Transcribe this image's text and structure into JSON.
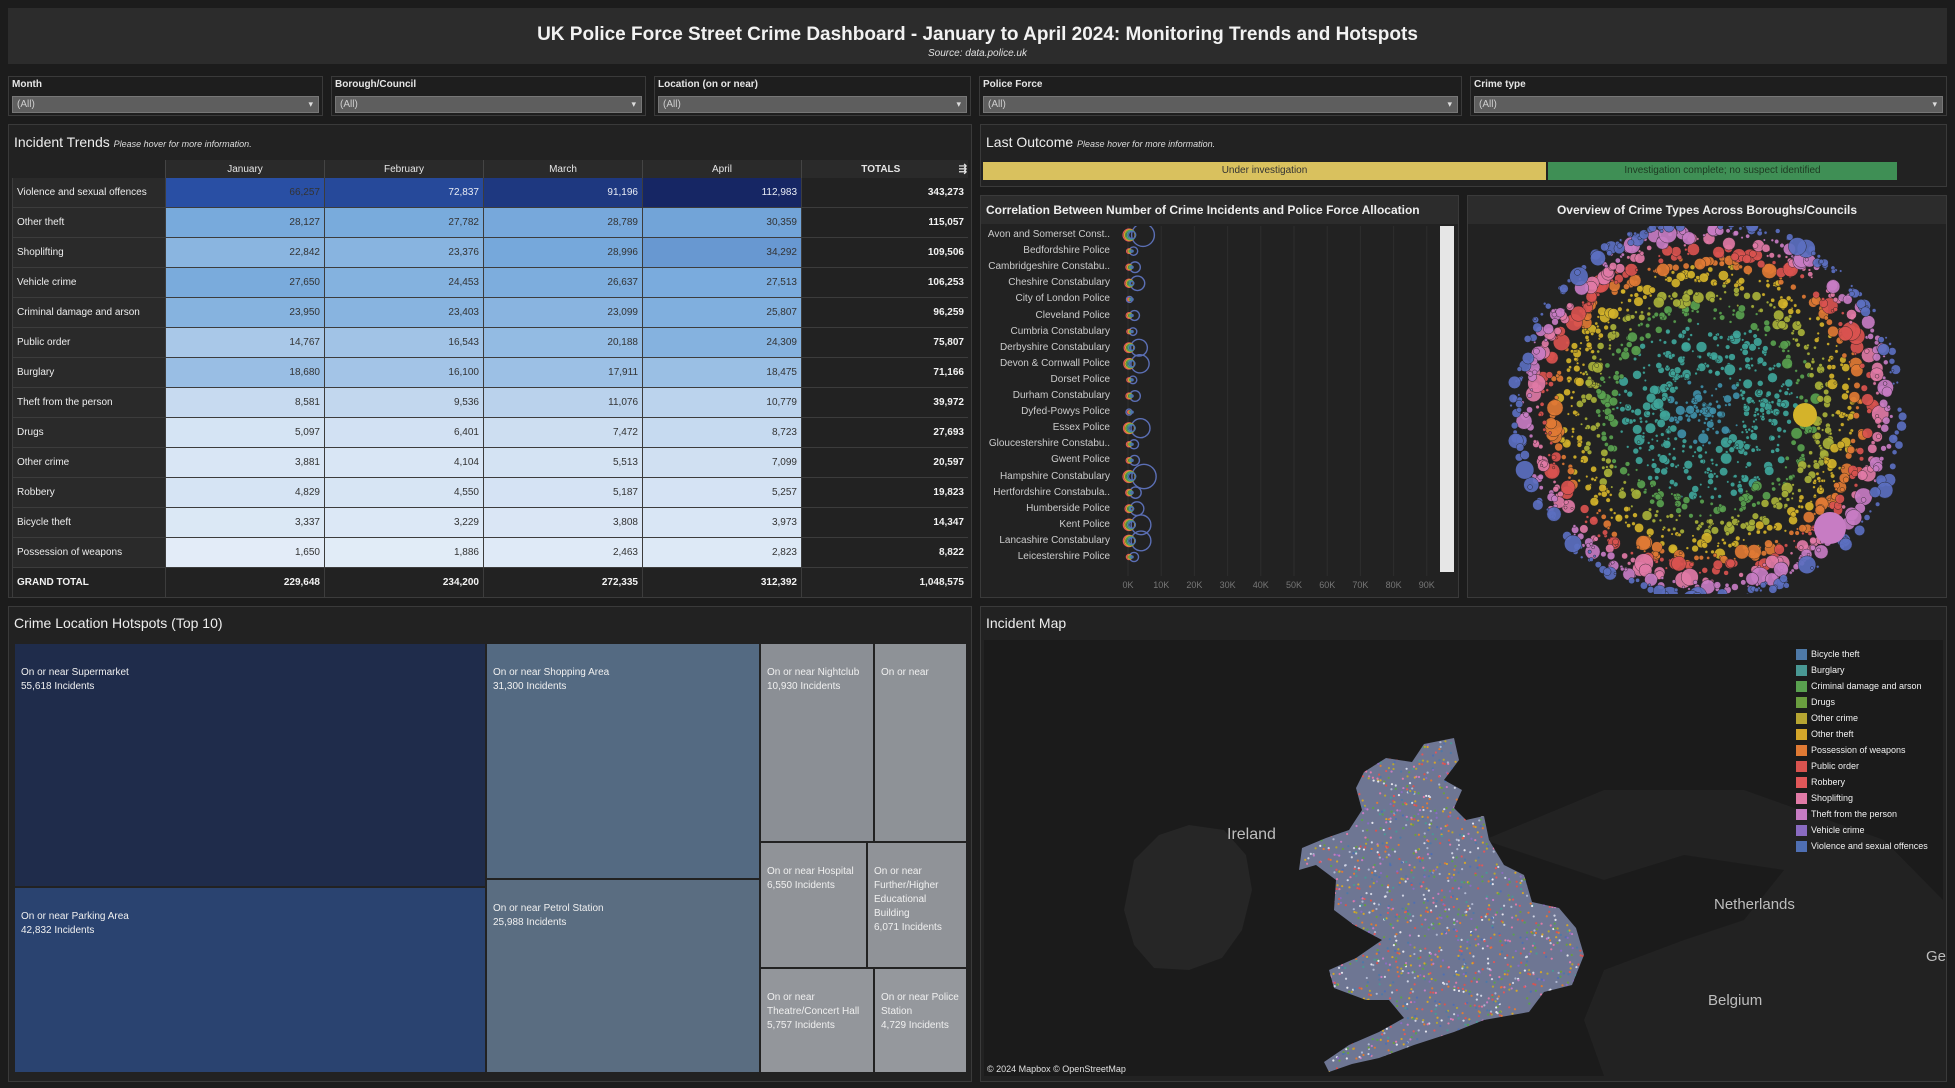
{
  "header": {
    "title": "UK Police Force Street Crime Dashboard - January to April 2024: Monitoring Trends and Hotspots",
    "source": "Source: data.police.uk"
  },
  "filters": [
    {
      "label": "Month",
      "value": "(All)"
    },
    {
      "label": "Borough/Council",
      "value": "(All)"
    },
    {
      "label": "Location (on or near)",
      "value": "(All)"
    },
    {
      "label": "Police Force",
      "value": "(All)"
    },
    {
      "label": "Crime type",
      "value": "(All)"
    }
  ],
  "incident_trends": {
    "title": "Incident Trends",
    "hint": "Please hover for more information.",
    "columns": [
      "January",
      "February",
      "March",
      "April",
      "TOTALS"
    ],
    "rows": [
      {
        "category": "Violence and sexual offences",
        "values": [
          "66,257",
          "72,837",
          "91,196",
          "112,983"
        ],
        "total": "343,273"
      },
      {
        "category": "Other theft",
        "values": [
          "28,127",
          "27,782",
          "28,789",
          "30,359"
        ],
        "total": "115,057"
      },
      {
        "category": "Shoplifting",
        "values": [
          "22,842",
          "23,376",
          "28,996",
          "34,292"
        ],
        "total": "109,506"
      },
      {
        "category": "Vehicle crime",
        "values": [
          "27,650",
          "24,453",
          "26,637",
          "27,513"
        ],
        "total": "106,253"
      },
      {
        "category": "Criminal damage and arson",
        "values": [
          "23,950",
          "23,403",
          "23,099",
          "25,807"
        ],
        "total": "96,259"
      },
      {
        "category": "Public order",
        "values": [
          "14,767",
          "16,543",
          "20,188",
          "24,309"
        ],
        "total": "75,807"
      },
      {
        "category": "Burglary",
        "values": [
          "18,680",
          "16,100",
          "17,911",
          "18,475"
        ],
        "total": "71,166"
      },
      {
        "category": "Theft from the person",
        "values": [
          "8,581",
          "9,536",
          "11,076",
          "10,779"
        ],
        "total": "39,972"
      },
      {
        "category": "Drugs",
        "values": [
          "5,097",
          "6,401",
          "7,472",
          "8,723"
        ],
        "total": "27,693"
      },
      {
        "category": "Other crime",
        "values": [
          "3,881",
          "4,104",
          "5,513",
          "7,099"
        ],
        "total": "20,597"
      },
      {
        "category": "Robbery",
        "values": [
          "4,829",
          "4,550",
          "5,187",
          "5,257"
        ],
        "total": "19,823"
      },
      {
        "category": "Bicycle theft",
        "values": [
          "3,337",
          "3,229",
          "3,808",
          "3,973"
        ],
        "total": "14,347"
      },
      {
        "category": "Possession of weapons",
        "values": [
          "1,650",
          "1,886",
          "2,463",
          "2,823"
        ],
        "total": "8,822"
      }
    ],
    "grand_total": {
      "label": "GRAND TOTAL",
      "values": [
        "229,648",
        "234,200",
        "272,335",
        "312,392"
      ],
      "total": "1,048,575"
    }
  },
  "last_outcome": {
    "title": "Last Outcome",
    "hint": "Please hover for more information.",
    "segments": [
      {
        "label": "Under investigation",
        "color": "#d9c15e"
      },
      {
        "label": "Investigation complete; no suspect identified",
        "color": "#3f8f55"
      }
    ]
  },
  "correlation": {
    "title": "Correlation Between Number of Crime Incidents and Police Force Allocation",
    "forces": [
      "Avon and Somerset Const..",
      "Bedfordshire Police",
      "Cambridgeshire Constabu..",
      "Cheshire Constabulary",
      "City of London Police",
      "Cleveland Police",
      "Cumbria Constabulary",
      "Derbyshire Constabulary",
      "Devon & Cornwall Police",
      "Dorset Police",
      "Durham Constabulary",
      "Dyfed-Powys Police",
      "Essex Police",
      "Gloucestershire Constabu..",
      "Gwent Police",
      "Hampshire Constabulary",
      "Hertfordshire Constabula..",
      "Humberside Police",
      "Kent Police",
      "Lancashire Constabulary",
      "Leicestershire Police"
    ],
    "axis_ticks": [
      "0K",
      "10K",
      "20K",
      "30K",
      "40K",
      "50K",
      "60K",
      "70K",
      "80K",
      "90K"
    ],
    "max_incidents_k": [
      30,
      11,
      14,
      19,
      3,
      13,
      10,
      22,
      24,
      10,
      14,
      2,
      25,
      12,
      13,
      32,
      15,
      18,
      26,
      26,
      12
    ]
  },
  "bubble_overview": {
    "title": "Overview of Crime Types Across Boroughs/Councils"
  },
  "hotspots": {
    "title": "Crime Location Hotspots (Top 10)",
    "items": [
      {
        "name": "On or near Supermarket",
        "count": "55,618 Incidents"
      },
      {
        "name": "On or near Parking Area",
        "count": "42,832 Incidents"
      },
      {
        "name": "On or near Shopping Area",
        "count": "31,300 Incidents"
      },
      {
        "name": "On or near Petrol Station",
        "count": "25,988 Incidents"
      },
      {
        "name": "On or near Nightclub",
        "count": "10,930 Incidents"
      },
      {
        "name": "On or near",
        "count": ""
      },
      {
        "name": "On or near Hospital",
        "count": "6,550 Incidents"
      },
      {
        "name": "On or near Further/Higher Educational Building",
        "count": "6,071 Incidents"
      },
      {
        "name": "On or near Theatre/Concert Hall",
        "count": "5,757 Incidents"
      },
      {
        "name": "On or near Police Station",
        "count": "4,729 Incidents"
      }
    ]
  },
  "incident_map": {
    "title": "Incident Map",
    "attribution": "© 2024 Mapbox  © OpenStreetMap",
    "places": [
      "Ireland",
      "Netherlands",
      "Belgium",
      "Ge"
    ],
    "legend": [
      {
        "label": "Bicycle theft",
        "color": "#4e79a7"
      },
      {
        "label": "Burglary",
        "color": "#499894"
      },
      {
        "label": "Criminal damage and arson",
        "color": "#59a14f"
      },
      {
        "label": "Drugs",
        "color": "#6a9e3f"
      },
      {
        "label": "Other crime",
        "color": "#b6a532"
      },
      {
        "label": "Other theft",
        "color": "#d4a62a"
      },
      {
        "label": "Possession of weapons",
        "color": "#e07a34"
      },
      {
        "label": "Public order",
        "color": "#d9534f"
      },
      {
        "label": "Robbery",
        "color": "#e15759"
      },
      {
        "label": "Shoplifting",
        "color": "#e07aa6"
      },
      {
        "label": "Theft from the person",
        "color": "#c77cc3"
      },
      {
        "label": "Vehicle crime",
        "color": "#8a6bc1"
      },
      {
        "label": "Violence and sexual offences",
        "color": "#4f6fb3"
      }
    ]
  }
}
